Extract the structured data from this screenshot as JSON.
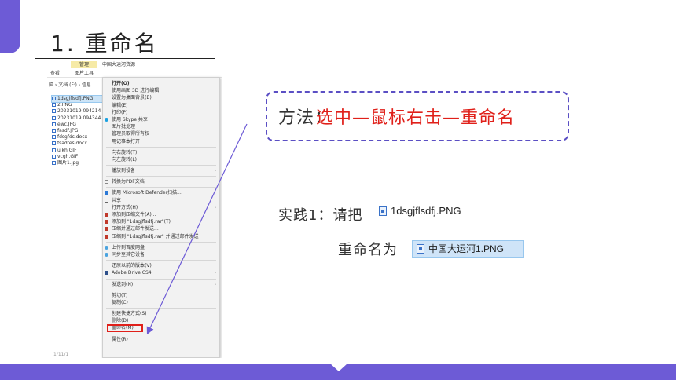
{
  "title": "1. 重命名",
  "explorer": {
    "ribbon_context": "管理",
    "ribbon_folder": "中国大运河资源",
    "tab_view": "查看",
    "tab_picture_tools": "图片工具",
    "breadcrumb": "脑 › 文档 (F:) › 信息",
    "files": [
      {
        "name": "1dsgjflsdfj.PNG",
        "selected": true
      },
      {
        "name": "2.PNG"
      },
      {
        "name": "20231019 094214"
      },
      {
        "name": "20231019 094344"
      },
      {
        "name": "ewc.JPG"
      },
      {
        "name": "fasdf.JPG"
      },
      {
        "name": "fdsgfds.docx"
      },
      {
        "name": "fsadfes.docx"
      },
      {
        "name": "uikh.GIF"
      },
      {
        "name": "vcgh.GIF"
      },
      {
        "name": "图片1.jpg"
      }
    ],
    "stray_text": "1/11/1",
    "context_menu": {
      "group1": [
        "打开(O)",
        "使用画图 3D 进行编辑",
        "设置为桌面背景(B)",
        "编辑(E)",
        "打印(P)",
        "使用 Skype 共享",
        "图片批处理",
        "管理员取得所有权",
        "用记事本打开"
      ],
      "group2": [
        "向右旋转(T)",
        "向左旋转(L)"
      ],
      "cast": "播放到设备",
      "pdf": "转换为PDF文档",
      "defender": "使用 Microsoft Defender扫描...",
      "share": "共享",
      "open_with": "打开方式(H)",
      "archive": [
        "添加到压缩文件(A)...",
        "添加到 \"1dsgjflsdfj.rar\"(T)",
        "压缩并通过邮件发送...",
        "压缩到 \"1dsgjflsdfj.rar\" 并通过邮件发送"
      ],
      "cloud": [
        "上传到百度网盘",
        "同步至其它设备"
      ],
      "restore": "还原以前的版本(V)",
      "adobe": "Adobe Drive CS4",
      "send_to": "发送到(N)",
      "clipboard": [
        "剪切(T)",
        "复制(C)"
      ],
      "shortcut": "创建快捷方式(S)",
      "delete": "删除(D)",
      "rename": "重命名(M)",
      "properties": "属性(R)"
    }
  },
  "method": {
    "label": "方法：",
    "text": "选中—鼠标右击—重命名"
  },
  "practice": {
    "label": "实践1：请把",
    "source_file": "1dsgjflsdfj.PNG",
    "rename_label": "重命名为",
    "target_file": "中国大运河1.PNG"
  },
  "colors": {
    "accent": "#6d5bd6",
    "highlight": "#e0201a"
  }
}
